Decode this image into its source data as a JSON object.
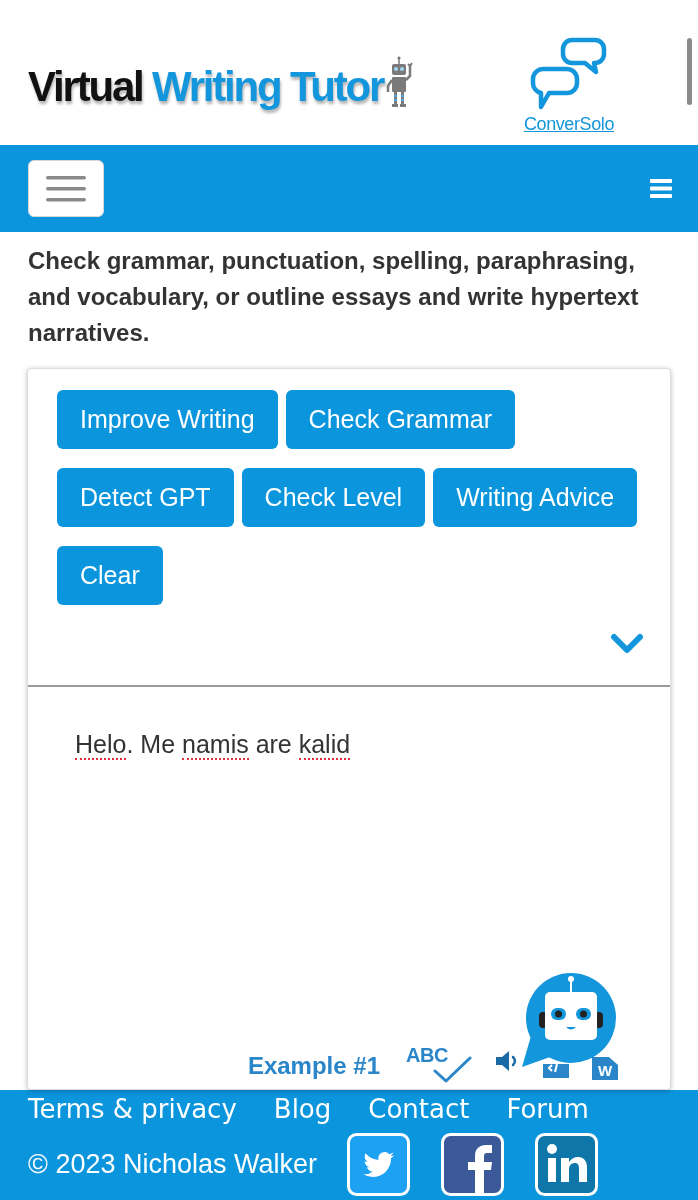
{
  "logo": {
    "parts": [
      {
        "text": "Virtual",
        "kind": "dark"
      },
      {
        "text": "Writing Tutor",
        "kind": "accent"
      }
    ]
  },
  "partner_link": {
    "label": "ConverSolo"
  },
  "intro": "Check grammar, punctuation, spelling, paraphrasing, and vocabulary, or outline essays and write hypertext narratives.",
  "actions": [
    "Improve Writing",
    "Check Grammar",
    "Detect GPT",
    "Check Level",
    "Writing Advice",
    "Clear"
  ],
  "options_expanded": false,
  "editor": {
    "segments": [
      {
        "text": "Helo",
        "misspelled": true
      },
      {
        "text": ". Me ",
        "misspelled": false
      },
      {
        "text": "namis",
        "misspelled": true
      },
      {
        "text": " are ",
        "misspelled": false
      },
      {
        "text": "kalid",
        "misspelled": true
      }
    ]
  },
  "tools": {
    "example_link": "Example #1",
    "spellcheck_label": "ABC",
    "word_export_label": "W"
  },
  "footer": {
    "links": [
      "Terms & privacy",
      "Blog",
      "Contact",
      "Forum"
    ],
    "copyright": "© 2023 Nicholas Walker"
  }
}
